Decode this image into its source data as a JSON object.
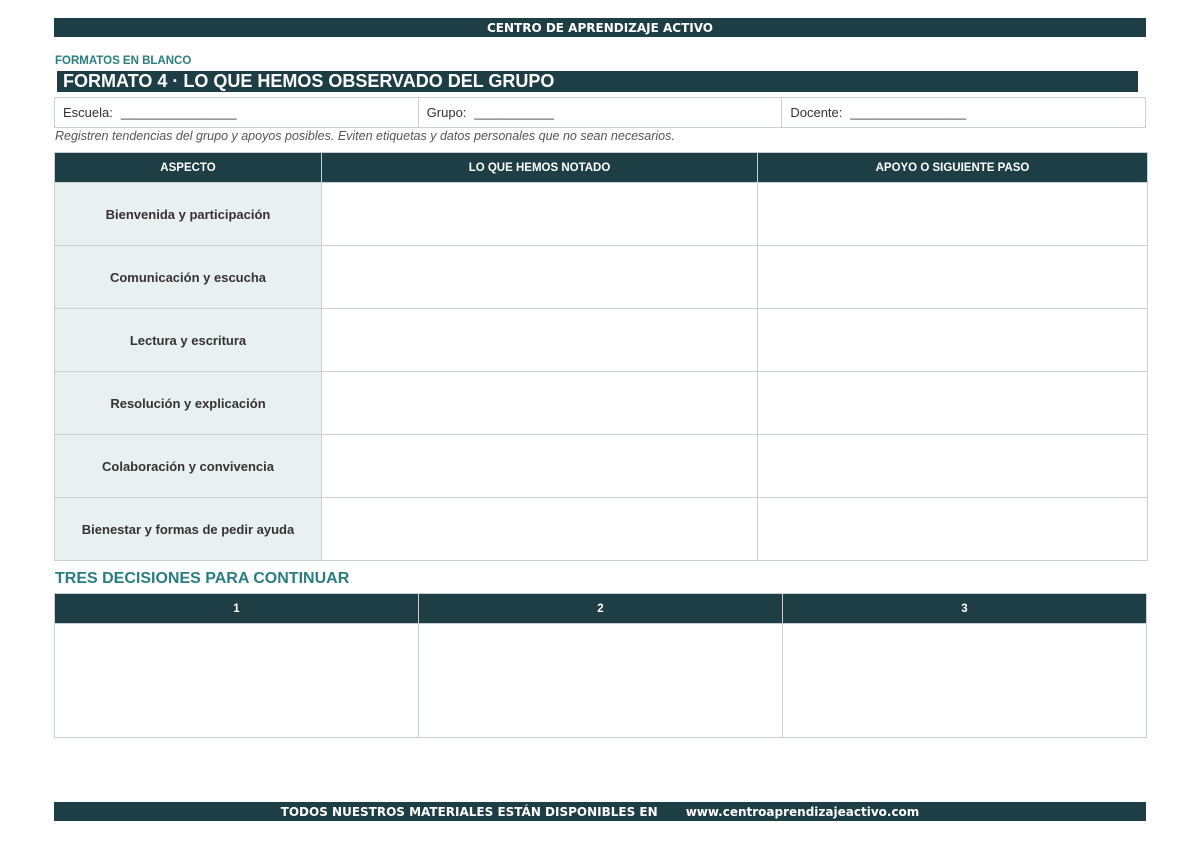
{
  "header": {
    "banner": "CENTRO DE APRENDIZAJE ACTIVO"
  },
  "form": {
    "section_label": "FORMATOS EN BLANCO",
    "title": "FORMATO 4 · LO QUE HEMOS OBSERVADO DEL GRUPO",
    "fields": [
      {
        "label": "Escuela:",
        "blank": "________________"
      },
      {
        "label": "Grupo:",
        "blank": "___________"
      },
      {
        "label": "Docente:",
        "blank": "________________"
      }
    ],
    "instructions": "Registren tendencias del grupo y apoyos posibles. Eviten etiquetas y datos personales que no sean necesarios."
  },
  "observation_table": {
    "headers": [
      "ASPECTO",
      "LO QUE HEMOS NOTADO",
      "APOYO O SIGUIENTE PASO"
    ],
    "rows": [
      "Bienvenida y participación",
      "Comunicación y escucha",
      "Lectura y escritura",
      "Resolución y explicación",
      "Colaboración y convivencia",
      "Bienestar y formas de pedir ayuda"
    ]
  },
  "decisions": {
    "title": "TRES DECISIONES PARA CONTINUAR",
    "headers": [
      "1",
      "2",
      "3"
    ]
  },
  "footer": {
    "text": "TODOS NUESTROS MATERIALES ESTÁN DISPONIBLES EN",
    "url": "www.centroaprendizajeactivo.com"
  }
}
